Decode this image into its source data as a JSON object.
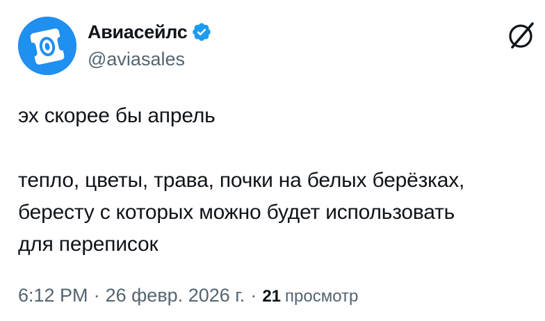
{
  "author": {
    "display_name": "Авиасейлс",
    "handle": "@aviasales",
    "verified": true,
    "avatar_icon": "aviasales-logo-icon",
    "avatar_color": "#1f8ff0"
  },
  "tweet": {
    "lines": [
      "эх скорее бы апрель",
      "тепло, цветы, трава, почки на белых берёзках,",
      "бересту с которых можно будет использовать",
      "для переписок"
    ]
  },
  "meta": {
    "time": "6:12 PM",
    "separator": "·",
    "date": "26 февр. 2026 г.",
    "views_count": "21",
    "views_label": "просмотр"
  },
  "icons": {
    "verified": "verified-badge-icon",
    "platform": "x-logo-icon"
  },
  "colors": {
    "verified_blue": "#1d9bf0",
    "text_primary": "#0f1419",
    "text_secondary": "#536471"
  }
}
